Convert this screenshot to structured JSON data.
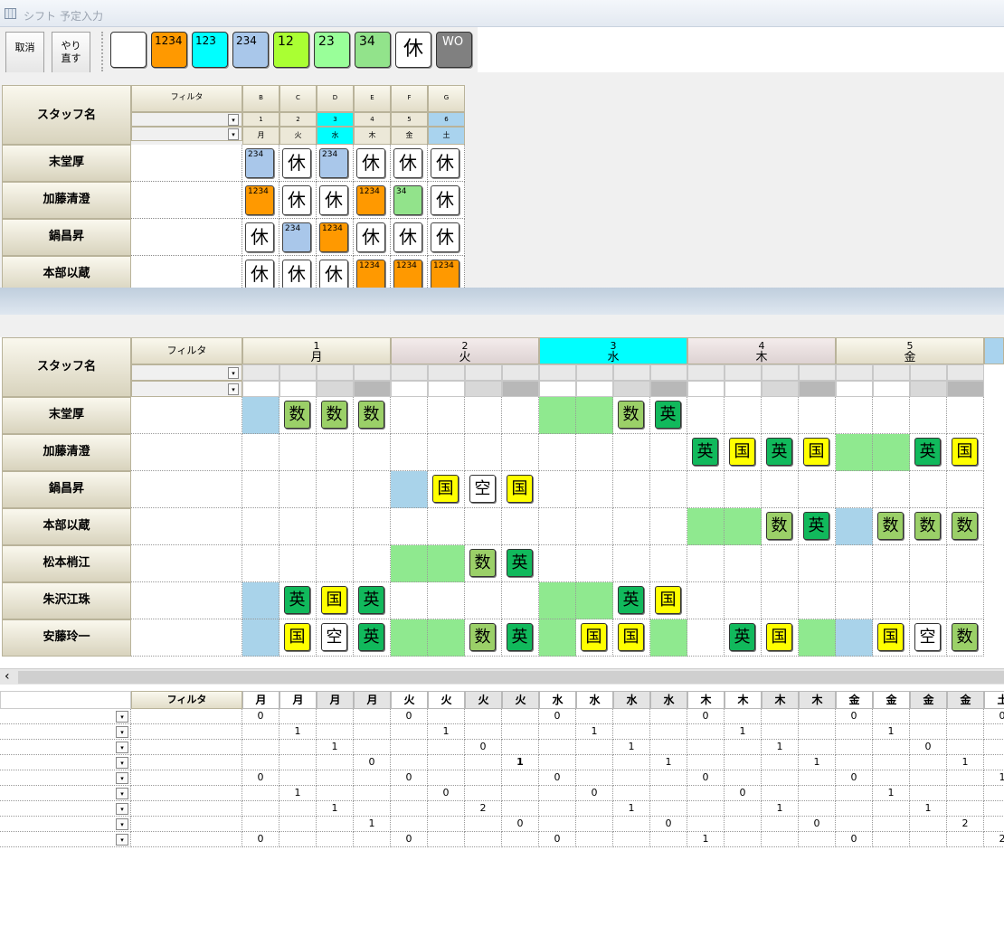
{
  "title_left": "シフト",
  "title_right": "予定入力",
  "toolbar": {
    "cancel": "取消",
    "redo": "やり直す"
  },
  "palette": [
    {
      "label": "",
      "bg": "#ffffff"
    },
    {
      "label": "1234",
      "bg": "#ff9900"
    },
    {
      "label": "123",
      "bg": "#00ffff"
    },
    {
      "label": "234",
      "bg": "#a9c7ea"
    },
    {
      "label": "12",
      "bg": "#aaff33"
    },
    {
      "label": "23",
      "bg": "#99ff99"
    },
    {
      "label": "34",
      "bg": "#92e38b"
    },
    {
      "label": "休",
      "bg": "#ffffff"
    },
    {
      "label": "WO",
      "bg": "#808080"
    }
  ],
  "top": {
    "staff_header": "スタッフ名",
    "filter": "フィルタ",
    "letters": [
      "B",
      "C",
      "D",
      "E",
      "F",
      "G"
    ],
    "nums": [
      "1",
      "2",
      "3",
      "4",
      "5",
      "6"
    ],
    "days": [
      "月",
      "火",
      "水",
      "木",
      "金",
      "土"
    ],
    "rows": [
      {
        "name": "末堂厚",
        "cells": [
          "234",
          "休",
          "234",
          "休",
          "休",
          "休"
        ]
      },
      {
        "name": "加藤清澄",
        "cells": [
          "1234",
          "休",
          "休",
          "1234",
          "34",
          "休"
        ]
      },
      {
        "name": "鍋昌昇",
        "cells": [
          "休",
          "234",
          "1234",
          "休",
          "休",
          "休"
        ]
      },
      {
        "name": "本部以蔵",
        "cells": [
          "休",
          "休",
          "休",
          "1234",
          "1234",
          "1234"
        ]
      }
    ]
  },
  "mid": {
    "staff_header": "スタッフ名",
    "filter": "フィルタ",
    "groups": [
      {
        "n": "1",
        "d": "月"
      },
      {
        "n": "2",
        "d": "火"
      },
      {
        "n": "3",
        "d": "水"
      },
      {
        "n": "4",
        "d": "木"
      },
      {
        "n": "5",
        "d": "金"
      }
    ],
    "rows": [
      {
        "name": "末堂厚",
        "cells": [
          "B",
          "数",
          "数",
          "数",
          "",
          "",
          "",
          "",
          "G",
          "G",
          "数",
          "英",
          "",
          "",
          "",
          "",
          "",
          "",
          "",
          ""
        ]
      },
      {
        "name": "加藤清澄",
        "cells": [
          "",
          "",
          "",
          "",
          "",
          "",
          "",
          "",
          "",
          "",
          "",
          "",
          "英",
          "国",
          "英",
          "国",
          "G",
          "G",
          "英",
          "国"
        ]
      },
      {
        "name": "鍋昌昇",
        "cells": [
          "",
          "",
          "",
          "",
          "B",
          "国",
          "空",
          "国",
          "",
          "",
          "",
          "",
          "",
          "",
          "",
          "",
          "",
          "",
          "",
          ""
        ]
      },
      {
        "name": "本部以蔵",
        "cells": [
          "",
          "",
          "",
          "",
          "",
          "",
          "",
          "",
          "",
          "",
          "",
          "",
          "G",
          "G",
          "数",
          "英",
          "B",
          "数",
          "数",
          "数"
        ]
      },
      {
        "name": "松本梢江",
        "cells": [
          "",
          "",
          "",
          "",
          "G",
          "G",
          "数",
          "英",
          "",
          "",
          "",
          "",
          "",
          "",
          "",
          "",
          "",
          "",
          "",
          ""
        ]
      },
      {
        "name": "朱沢江珠",
        "cells": [
          "B",
          "英",
          "国",
          "英",
          "",
          "",
          "",
          "",
          "G",
          "G",
          "英",
          "国",
          "",
          "",
          "",
          "",
          "",
          "",
          "",
          ""
        ]
      },
      {
        "name": "安藤玲一",
        "cells": [
          "B",
          "国",
          "空",
          "英",
          "G",
          "G",
          "数",
          "英",
          "G",
          "国",
          "国",
          "G",
          "",
          "英",
          "国",
          "G",
          "B",
          "国",
          "空",
          "数"
        ]
      }
    ]
  },
  "bottom": {
    "filter": "フィルタ",
    "days": [
      "月",
      "月",
      "月",
      "月",
      "火",
      "火",
      "火",
      "火",
      "水",
      "水",
      "水",
      "水",
      "木",
      "木",
      "木",
      "木",
      "金",
      "金",
      "金",
      "金",
      "土"
    ],
    "rows": [
      [
        "0",
        "",
        "",
        "",
        "0",
        "",
        "",
        "",
        "0",
        "",
        "",
        "",
        "0",
        "",
        "",
        "",
        "0",
        "",
        "",
        "",
        "0"
      ],
      [
        "",
        "1",
        "",
        "",
        "",
        "1",
        "",
        "",
        "",
        "1",
        "",
        "",
        "",
        "1",
        "",
        "",
        "",
        "1",
        "",
        "",
        ""
      ],
      [
        "",
        "",
        "1",
        "",
        "",
        "",
        "0",
        "",
        "",
        "",
        "1",
        "",
        "",
        "",
        "1",
        "",
        "",
        "",
        "0",
        "",
        ""
      ],
      [
        "",
        "",
        "",
        "0",
        "",
        "",
        "",
        "1",
        "",
        "",
        "",
        "1",
        "",
        "",
        "",
        "1",
        "",
        "",
        "",
        "1",
        ""
      ],
      [
        "0",
        "",
        "",
        "",
        "0",
        "",
        "",
        "",
        "0",
        "",
        "",
        "",
        "0",
        "",
        "",
        "",
        "0",
        "",
        "",
        "",
        "1"
      ],
      [
        "",
        "1",
        "",
        "",
        "",
        "0",
        "",
        "",
        "",
        "0",
        "",
        "",
        "",
        "0",
        "",
        "",
        "",
        "1",
        "",
        "",
        ""
      ],
      [
        "",
        "",
        "1",
        "",
        "",
        "",
        "2",
        "",
        "",
        "",
        "1",
        "",
        "",
        "",
        "1",
        "",
        "",
        "",
        "1",
        "",
        ""
      ],
      [
        "",
        "",
        "",
        "1",
        "",
        "",
        "",
        "0",
        "",
        "",
        "",
        "0",
        "",
        "",
        "",
        "0",
        "",
        "",
        "",
        "2",
        ""
      ],
      [
        "0",
        "",
        "",
        "",
        "0",
        "",
        "",
        "",
        "0",
        "",
        "",
        "",
        "1",
        "",
        "",
        "",
        "0",
        "",
        "",
        "",
        "2"
      ]
    ]
  }
}
